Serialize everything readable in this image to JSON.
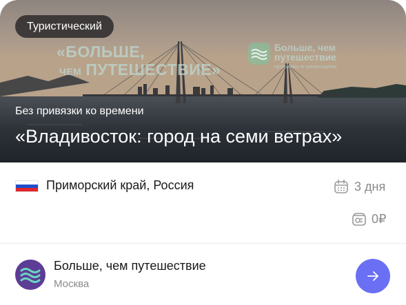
{
  "card": {
    "category_chip": "Туристический",
    "promo": {
      "quote_left_line1": "«БОЛЬШЕ,",
      "quote_left_line2_small": "ЧЕМ",
      "quote_left_line2_big": "ПУТЕШЕСТВИЕ»",
      "brand_line1": "Больше, чем",
      "brand_line2": "путешествие",
      "brand_line3": "программа от росмолодёжи"
    },
    "schedule_note": "Без привязки ко времени",
    "title": "«Владивосток: город на семи ветрах»",
    "region": "Приморский край, Россия",
    "flag_colors": [
      "#ffffff",
      "#1f4fc9",
      "#e0252b"
    ],
    "duration": "3 дня",
    "duration_icon": "calendar-icon",
    "price": "0₽",
    "price_icon": "wallet-icon",
    "organizer": {
      "name": "Больше, чем путешествие",
      "city": "Москва",
      "avatar_icon": "waves-logo-icon"
    },
    "open_button_icon": "arrow-right-icon",
    "accent_color": "#6a6ff3"
  }
}
